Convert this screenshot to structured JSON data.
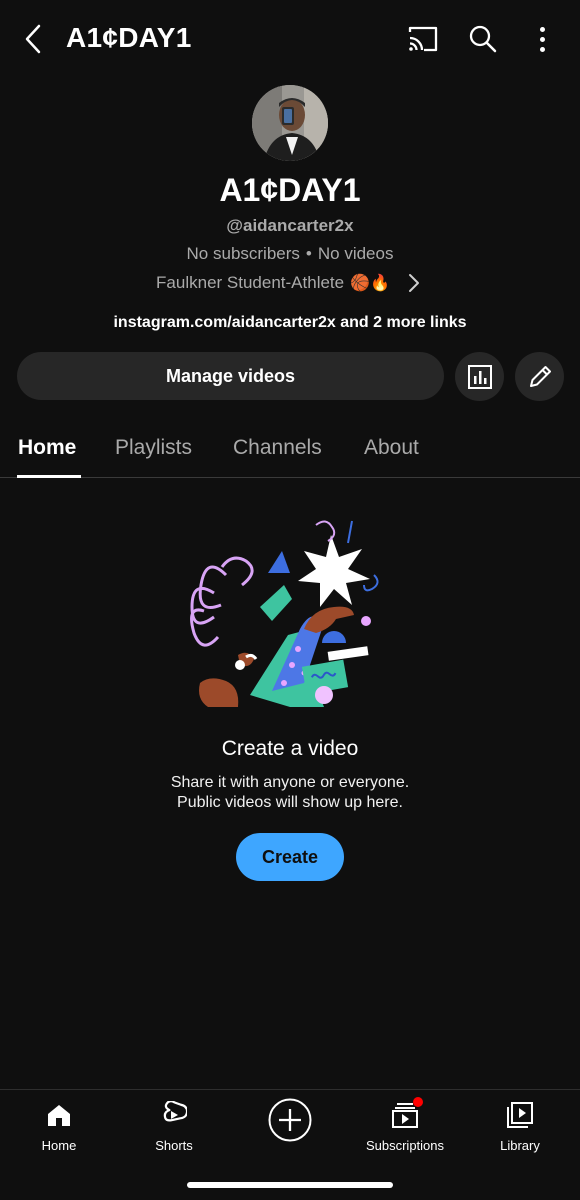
{
  "header": {
    "title": "A1¢DAY1",
    "icons": [
      "back-icon",
      "cast-icon",
      "search-icon",
      "more-vertical-icon"
    ]
  },
  "channel": {
    "name": "A1¢DAY1",
    "handle": "@aidancarter2x",
    "subscribers": "No subscribers",
    "separator": "•",
    "videos": "No videos",
    "bio": "Faulkner Student-Athlete",
    "bio_emojis": "🏀🔥",
    "links": "instagram.com/aidancarter2x and 2 more links"
  },
  "actions": {
    "manage_label": "Manage videos",
    "analytics_icon": "analytics-icon",
    "edit_icon": "pencil-icon"
  },
  "tabs": [
    {
      "label": "Home",
      "active": true
    },
    {
      "label": "Playlists",
      "active": false
    },
    {
      "label": "Channels",
      "active": false
    },
    {
      "label": "About",
      "active": false
    }
  ],
  "empty_state": {
    "title": "Create a video",
    "line1": "Share it with anyone or everyone.",
    "line2": "Public videos will show up here.",
    "button": "Create"
  },
  "bottom_nav": [
    {
      "label": "Home",
      "icon": "home-icon"
    },
    {
      "label": "Shorts",
      "icon": "shorts-icon"
    },
    {
      "label": "",
      "icon": "create-plus-icon"
    },
    {
      "label": "Subscriptions",
      "icon": "subscriptions-icon"
    },
    {
      "label": "Library",
      "icon": "library-icon"
    }
  ],
  "colors": {
    "background": "#0f0f0f",
    "button_bg": "#272727",
    "accent": "#3ea6ff",
    "notification": "#ff0000"
  }
}
